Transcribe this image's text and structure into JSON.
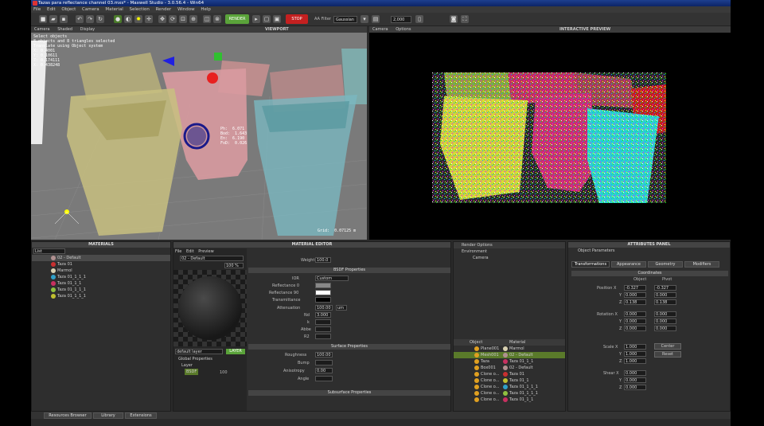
{
  "window": {
    "title": "Tazas para reflectance channel 03.mxs* - Maxwell Studio - 3.0.56.4 - Win64"
  },
  "menu": [
    "File",
    "Edit",
    "Object",
    "Camera",
    "Material",
    "Selection",
    "Render",
    "Window",
    "Help"
  ],
  "toolbar": {
    "render_label": "RENDER",
    "stop_label": "STOP",
    "aa_filter_label": "AA Filter",
    "aa_filter_value": "Gaussian",
    "resolution": "2,000"
  },
  "viewport": {
    "title": "VIEWPORT",
    "tabs": [
      "Camera",
      "Shaded",
      "Display"
    ],
    "info": "Select objects\n8 objects and 8 triangles selected\nTranslate using Object system\nX: 0.4001\nY: 0.10611\nZ: 0.174111\nX: 0.438248",
    "stats": "Ph:  6.071\nBod:  1.643\nEn:  6.190\nFoD:  0.026",
    "grid": "Grid:  0.07125 m"
  },
  "preview": {
    "title": "INTERACTIVE PREVIEW",
    "tabs": [
      "Camera",
      "Options"
    ]
  },
  "materials": {
    "title": "MATERIALS",
    "filter": "List",
    "selected": "02 - Default",
    "items": [
      {
        "name": "02 - Default",
        "color": "#b09090"
      },
      {
        "name": "Taza 01",
        "color": "#c83030"
      },
      {
        "name": "Marmol",
        "color": "#d8d0b0"
      },
      {
        "name": "Taza 01_1_1_1",
        "color": "#30a0c8"
      },
      {
        "name": "Taza 01_1_1",
        "color": "#c83060"
      },
      {
        "name": "Taza 01_1_1_1",
        "color": "#90c040"
      },
      {
        "name": "Taza 01_1_1_1",
        "color": "#c0c030"
      }
    ]
  },
  "mateditor": {
    "title": "MATERIAL EDITOR",
    "menu": [
      "File",
      "Edit",
      "Preview"
    ],
    "name": "02 - Default",
    "zoom": "100 %",
    "weight_label": "Weight",
    "weight": "100.0",
    "bsdf_title": "BSDF Properties",
    "ior_label": "IOR",
    "ior_value": "Custom",
    "refl0": "Reflectance 0",
    "refl90": "Reflectance 90",
    "trans": "Transmittance",
    "atten_label": "Attenuation",
    "atten_value": "100.00",
    "atten_unit": "um",
    "nd_label": "Nd",
    "nd_value": "3.000",
    "k_label": "k",
    "abbe_label": "Abbe",
    "r2_label": "R2",
    "surface_title": "Surface Properties",
    "rough_label": "Roughness",
    "rough_value": "100.00",
    "bump_label": "Bump",
    "aniso_label": "Anisotropy",
    "aniso_value": "0.00",
    "angle_label": "Angle",
    "subsurface_title": "Subsurface Properties",
    "layers_label": "default layer",
    "add_layer": "LAYER",
    "tree": [
      "Global Properties",
      "Layer",
      "BSDF"
    ],
    "tree_weight": "100"
  },
  "scene": {
    "top": [
      "Render Options",
      "Environment",
      "Camera"
    ],
    "headers": [
      "Object",
      "Material"
    ],
    "rows": [
      {
        "obj": "Plane001",
        "mat": "Marmol",
        "color": "#d8d0b0"
      },
      {
        "obj": "Mesh001",
        "mat": "02 - Default",
        "color": "#b09090"
      },
      {
        "obj": "Taza",
        "mat": "Taza 01_1_1",
        "color": "#c83060"
      },
      {
        "obj": "Box001",
        "mat": "02 - Default",
        "color": "#b09090"
      },
      {
        "obj": "Clone o...",
        "mat": "Taza 01",
        "color": "#c83030"
      },
      {
        "obj": "Clone o...",
        "mat": "Taza 01_1",
        "color": "#c0c030"
      },
      {
        "obj": "Clone o...",
        "mat": "Taza 01_1_1_1",
        "color": "#30a0c8"
      },
      {
        "obj": "Clone o...",
        "mat": "Taza 01_1_1_1",
        "color": "#90c040"
      },
      {
        "obj": "Clone o...",
        "mat": "Taza 01_1_1",
        "color": "#c83060"
      }
    ]
  },
  "attributes": {
    "title": "ATTRIBUTES PANEL",
    "subtitle": "Object Parameters",
    "tabs": [
      "Transformations",
      "Appearance",
      "Geometry",
      "Modifiers"
    ],
    "section": "Coordinates",
    "col_object": "Object",
    "col_pivot": "Pivot",
    "position": {
      "label": "Position X",
      "x": "-0.327",
      "y": "0.000",
      "z": "0.138",
      "px": "-0.327",
      "py": "0.000",
      "pz": "0.138"
    },
    "rotation": {
      "label": "Rotation X",
      "x": "0.000",
      "y": "0.000",
      "z": "0.000",
      "px": "0.000",
      "py": "0.000",
      "pz": "0.000"
    },
    "scale": {
      "label": "Scale X",
      "x": "1.000",
      "y": "1.000",
      "z": "1.000"
    },
    "shear": {
      "label": "Shear X",
      "x": "0.000",
      "y": "0.000",
      "z": "0.000"
    },
    "y_label": "Y",
    "z_label": "Z",
    "center_btn": "Center",
    "reset_btn": "Reset"
  },
  "statusbar": {
    "tabs": [
      "Resources Browser",
      "Library",
      "Extensions"
    ]
  }
}
